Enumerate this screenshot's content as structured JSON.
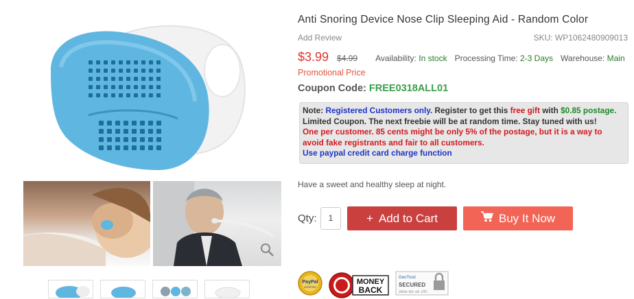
{
  "product": {
    "title": "Anti Snoring Device Nose Clip Sleeping Aid - Random Color",
    "add_review": "Add Review",
    "sku": "SKU: WP1062480909013",
    "price": "$3.99",
    "old_price": "$4.99",
    "availability_label": "Availability:",
    "availability_value": "In stock",
    "processing_label": "Processing Time:",
    "processing_value": "2-3 Days",
    "warehouse_label": "Warehouse:",
    "warehouse_value": "Main",
    "promo": "Promotional Price",
    "coupon_label": "Coupon Code:",
    "coupon_code": "FREE0318ALL01",
    "tagline": "Have a sweet and healthy sleep at night."
  },
  "note": {
    "label": "Note:",
    "registered": "Registered Customers only.",
    "register_text": "Register to get this",
    "free_gift": "free gift",
    "with": "with",
    "postage": "$0.85 postage.",
    "line2": "Limited Coupon. The next freebie will be at random time. Stay tuned with us!",
    "line3": "One per customer. 85 cents might be only 5% of the postage, but it is a way to avoid fake registrants and fair to all customers.",
    "line4": "Use paypal credit card charge function"
  },
  "purchase": {
    "qty_label": "Qty:",
    "qty_value": "1",
    "add_to_cart": "Add to Cart",
    "buy_now": "Buy It Now"
  },
  "badges": {
    "paypal": "PayPal VERIFIED",
    "money_back": "MONEY BACK",
    "secured": "SECURED",
    "geotrust": "GeoTrust",
    "secured_date": "2018-03-19 UTC"
  },
  "colors": {
    "device_blue": "#5fb6e0",
    "price_red": "#dd3333",
    "cart_button": "#c9403f",
    "buy_button": "#f26455",
    "coupon_green": "#3c9e4b"
  }
}
